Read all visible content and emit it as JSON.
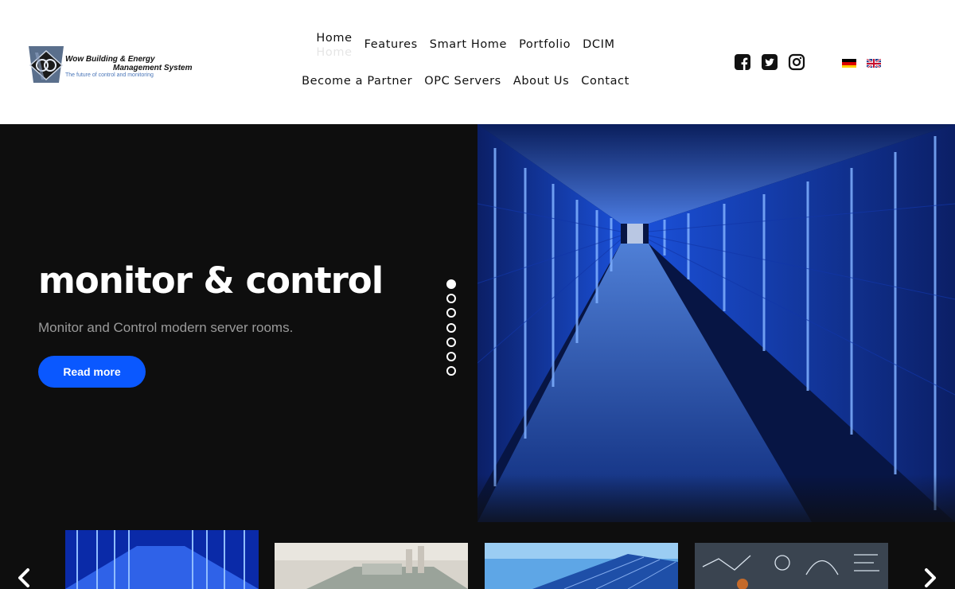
{
  "logo": {
    "title_line1": "Wow Building & Energy",
    "title_line2": "Management System",
    "tagline": "The future of control and monitoring"
  },
  "nav": {
    "row1": [
      "Home",
      "Features",
      "Smart Home",
      "Portfolio",
      "DCIM"
    ],
    "row2": [
      "Become a Partner",
      "OPC Servers",
      "About Us",
      "Contact"
    ]
  },
  "social": [
    "facebook-icon",
    "twitter-icon",
    "instagram-icon"
  ],
  "languages": [
    "german-flag-icon",
    "english-flag-icon"
  ],
  "hero": {
    "title": "monitor & control",
    "subtitle": "Monitor and Control modern server rooms.",
    "button_label": "Read more",
    "slide_count": 7,
    "active_slide": 1
  },
  "thumbnails": [
    "server-room-thumbnail",
    "industrial-plant-thumbnail",
    "solar-panels-thumbnail",
    "analytics-board-thumbnail"
  ],
  "colors": {
    "accent": "#0a58ff",
    "hero_bg": "#0e0e0e",
    "server_blue": "#1f5cff"
  }
}
